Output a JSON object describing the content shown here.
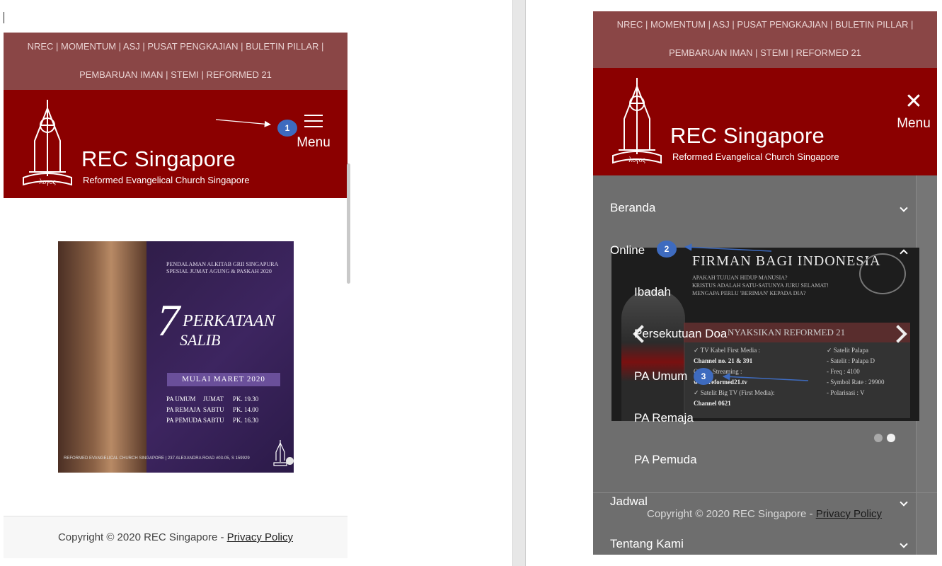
{
  "topbar": {
    "line1": "NREC | MOMENTUM | ASJ | PUSAT PENGKAJIAN | BULETIN PILLAR |",
    "line2": "PEMBARUAN IMAN | STEMI | REFORMED 21"
  },
  "site": {
    "name": "REC Singapore",
    "tagline": "Reformed Evangelical Church Singapore"
  },
  "header": {
    "menu_label": "Menu",
    "close_label": "Menu"
  },
  "banner": {
    "line1": "PENDALAMAN ALKITAB GRII SINGAPURA",
    "line2": "SPESIAL JUMAT AGUNG & PASKAH 2020",
    "number": "7",
    "title1": "PERKATAAN",
    "title2": "SALIB",
    "start": "MULAI MARET 2020",
    "schedule": [
      {
        "name": "PA UMUM",
        "day": "JUMAT",
        "time": "PK. 19.30"
      },
      {
        "name": "PA REMAJA",
        "day": "SABTU",
        "time": "PK. 14.00"
      },
      {
        "name": "PA PEMUDA",
        "day": "SABTU",
        "time": "PK. 16.30"
      }
    ],
    "footer": "REFORMED EVANGELICAL CHURCH SINGAPORE | 237 ALEXANDRA ROAD #03-05, S 159929"
  },
  "slider": {
    "title": "FIRMAN BAGI INDONESIA",
    "q1": "APAKAH TUJUAN HIDUP MANUSIA?",
    "q2": "KRISTUS ADALAH SATU-SATUNYA JURU SELAMAT!",
    "q3": "MENGAPA PERLU 'BERIMAN' KEPADA DIA?",
    "watch": "NYAKSIKAN REFORMED 21",
    "left_col": [
      "✓ TV Kabel First Media :",
      "Channel no. 21 & 391",
      "Online Streaming :",
      "www.reformed21.tv",
      "✓ Satelit Big TV (First Media):",
      "Channel 0621"
    ],
    "right_col": [
      "✓ Satelit Palapa",
      "- Satelit : Palapa D",
      "- Freq : 4100",
      "- Symbol Rate : 29900",
      "- Polarisasi : V"
    ]
  },
  "menu": {
    "items": [
      "Beranda",
      "Online",
      "Jadwal",
      "Tentang Kami"
    ],
    "online_sub": [
      "Ibadah",
      "Persekutuan Doa",
      "PA Umum",
      "PA Remaja",
      "PA Pemuda"
    ]
  },
  "footer": {
    "copyright": "Copyright © 2020 REC Singapore  -",
    "privacy": "Privacy Policy"
  },
  "annotations": [
    "1",
    "2",
    "3"
  ],
  "colors": {
    "topbar": "#8a4646",
    "header": "#8b0000",
    "menu_bg": "#6e6e6e",
    "badge": "#3e6bbf"
  }
}
